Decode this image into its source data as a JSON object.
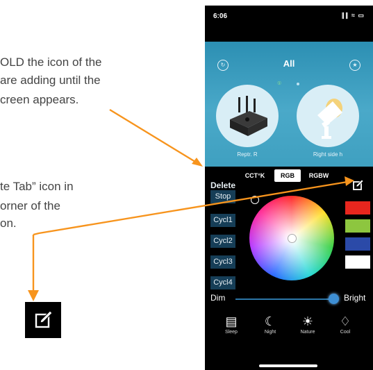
{
  "instructions": {
    "line1": "OLD the icon of the",
    "line2": "are adding until the",
    "line3": "creen appears.",
    "line4": "te Tab” icon in",
    "line5": "orner of the",
    "line6": "on."
  },
  "status_bar": {
    "time": "6:06",
    "signal": "∥∥ ≈ ▭"
  },
  "header": {
    "title": "All",
    "left_icon": "refresh-icon",
    "right_icon": "star-icon"
  },
  "devices": [
    {
      "label": "Reptr. R",
      "icon": "repeater-icon"
    },
    {
      "label": "Right side h",
      "icon": "spotlight-icon"
    }
  ],
  "device_indicator": "①",
  "controls": {
    "delete": "Delete",
    "side_buttons": [
      "Stop",
      "Cycl1",
      "Cycl2",
      "Cycl3",
      "Cycl4"
    ],
    "tabs": [
      "CCT°K",
      "RGB",
      "RGBW"
    ],
    "selected_tab": "RGB",
    "dim": "Dim",
    "bright": "Bright",
    "brightness": 0.95
  },
  "swatches": [
    "#e8261e",
    "#8dc63f",
    "#2b4aa8",
    "#ffffff"
  ],
  "scenes": [
    {
      "label": "Sleep",
      "icon": "bed-icon",
      "glyph": "▤"
    },
    {
      "label": "Night",
      "icon": "moon-icon",
      "glyph": "☾"
    },
    {
      "label": "Nature",
      "icon": "sun-icon",
      "glyph": "☀"
    },
    {
      "label": "Cool",
      "icon": "bulb-icon",
      "glyph": "♢"
    }
  ],
  "colors": {
    "accent_arrow": "#f7941d",
    "panel": "#3a9cc0",
    "button": "#163e57"
  }
}
